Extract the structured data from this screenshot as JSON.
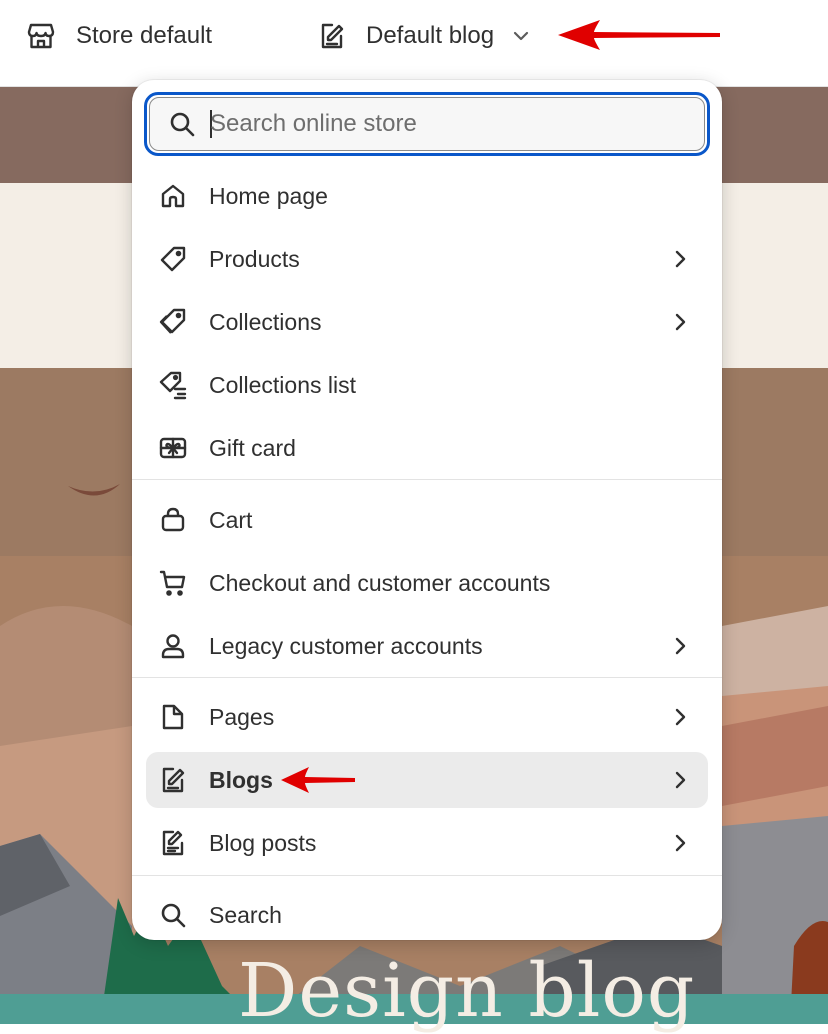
{
  "topbar": {
    "store_label": "Store default",
    "blog_label": "Default blog",
    "store_icon": "store-icon",
    "blog_icon": "edit-document-icon",
    "chevron_icon": "chevron-down-icon"
  },
  "search": {
    "placeholder": "Search online store",
    "value": ""
  },
  "menu": {
    "items": [
      {
        "label": "Home page",
        "icon": "home-icon",
        "has_submenu": false
      },
      {
        "label": "Products",
        "icon": "tag-icon",
        "has_submenu": true
      },
      {
        "label": "Collections",
        "icon": "collection-tag-icon",
        "has_submenu": true
      },
      {
        "label": "Collections list",
        "icon": "collection-list-icon",
        "has_submenu": false
      },
      {
        "label": "Gift card",
        "icon": "gift-card-icon",
        "has_submenu": false
      },
      {
        "label": "Cart",
        "icon": "bag-icon",
        "has_submenu": false
      },
      {
        "label": "Checkout and customer accounts",
        "icon": "cart-icon",
        "has_submenu": false
      },
      {
        "label": "Legacy customer accounts",
        "icon": "person-icon",
        "has_submenu": true
      },
      {
        "label": "Pages",
        "icon": "page-icon",
        "has_submenu": true
      },
      {
        "label": "Blogs",
        "icon": "blog-icon",
        "has_submenu": true,
        "selected": true
      },
      {
        "label": "Blog posts",
        "icon": "blog-post-icon",
        "has_submenu": true
      },
      {
        "label": "Search",
        "icon": "search-icon",
        "has_submenu": false
      }
    ]
  },
  "preview": {
    "heading": "Design blog"
  },
  "colors": {
    "accent_focus": "#0a57c9",
    "annotation_arrow": "#e00000",
    "selected_row": "#ebebeb",
    "text": "#303030"
  }
}
